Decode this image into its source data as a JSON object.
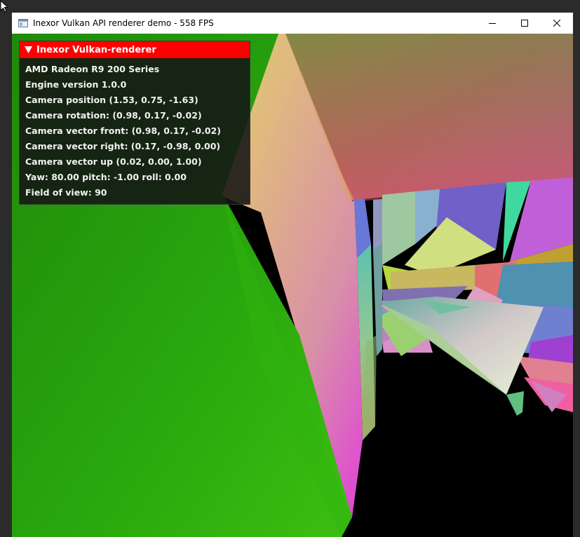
{
  "window": {
    "title": "Inexor Vulkan API renderer demo - 558 FPS",
    "icon": "app-window-icon",
    "controls": {
      "minimize": "minimize-icon",
      "maximize": "maximize-icon",
      "close": "close-icon"
    }
  },
  "overlay": {
    "title": "Inexor Vulkan-renderer",
    "header_color": "#ff0000",
    "lines": [
      "AMD Radeon R9 200 Series",
      "Engine version 1.0.0",
      "Camera position (1.53, 0.75, -1.63)",
      "Camera rotation: (0.98, 0.17, -0.02)",
      "Camera vector front: (0.98, 0.17, -0.02)",
      "Camera vector right: (0.17, -0.98, 0.00)",
      "Camera vector up (0.02, 0.00, 1.00)",
      "Yaw: 80.00 pitch: -1.00 roll: 0.00",
      "Field of view: 90"
    ]
  }
}
